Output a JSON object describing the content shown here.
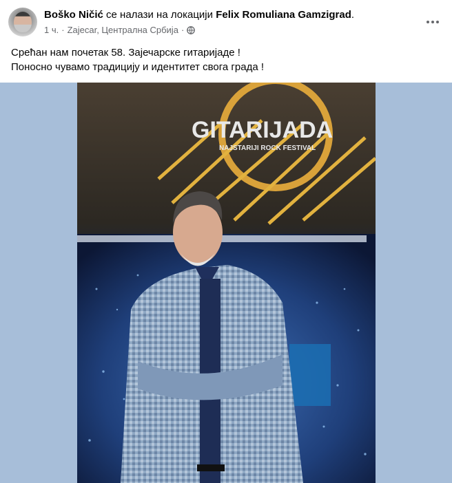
{
  "post": {
    "author": "Boško Ničić",
    "location_prefix": "се налази на локацији",
    "location": "Felix Romuliana Gamzigrad",
    "title_end": ".",
    "time": "1 ч.",
    "separator": "·",
    "place": "Zajecar, Централна Србија",
    "privacy_icon": "globe-icon",
    "more_icon": "more-options-icon",
    "text_lines": [
      "Срећан нам почетак 58. Зајечарске гитаријаде !",
      "Поносно чувамо традицију и идентитет свога града !"
    ]
  },
  "photo": {
    "banner_title": "GITARIJADA",
    "banner_subtitle": "NAJSTARIJI ROCK FESTIVAL",
    "background_color": "#a7bed9"
  }
}
